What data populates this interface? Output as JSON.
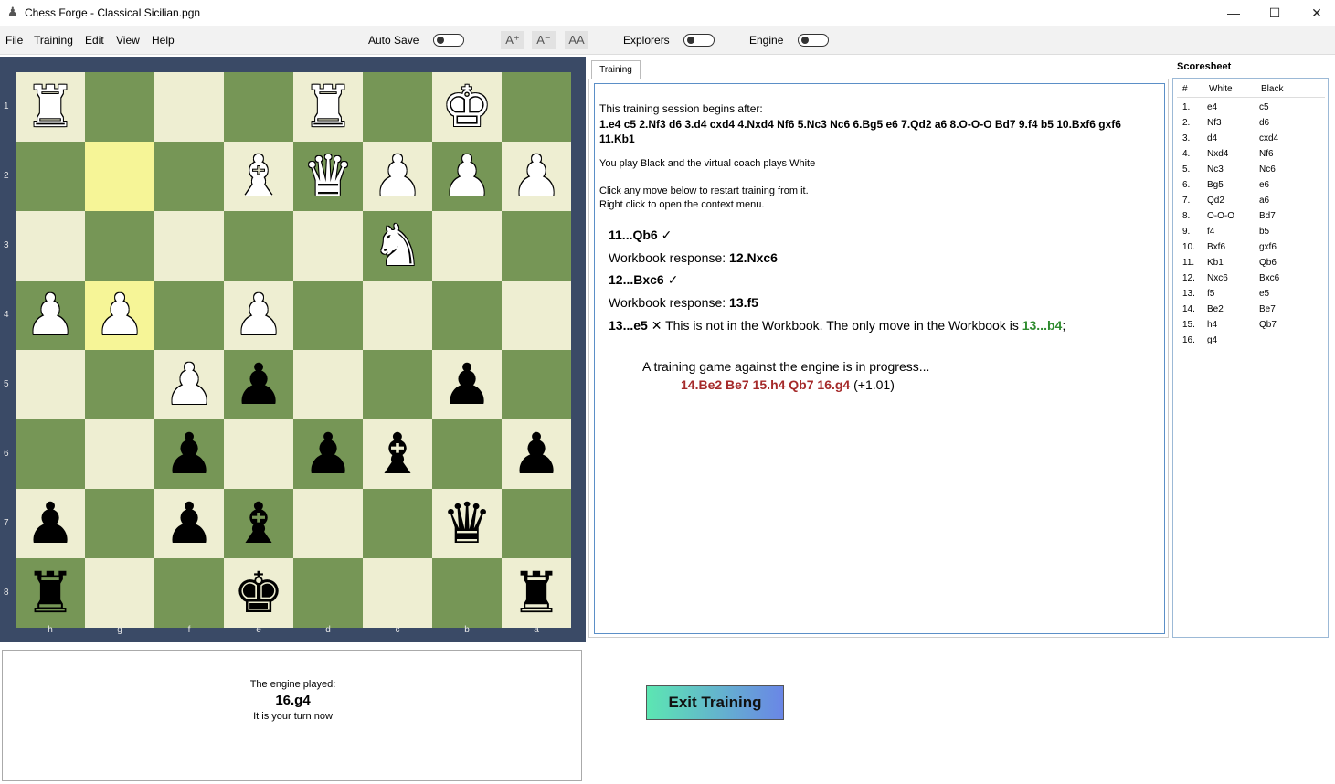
{
  "window": {
    "title": "Chess Forge - Classical Sicilian.pgn",
    "icon": "chess-pawn-icon",
    "minimize": "—",
    "maximize": "☐",
    "close": "✕"
  },
  "menu": [
    "File",
    "Training",
    "Edit",
    "View",
    "Help"
  ],
  "toolbar": {
    "auto_save": "Auto Save",
    "font_up": "A⁺",
    "font_down": "A⁻",
    "font_fixed": "AA",
    "explorers": "Explorers",
    "engine": "Engine"
  },
  "board": {
    "orientation": "black",
    "rank_labels": [
      "1",
      "2",
      "3",
      "4",
      "5",
      "6",
      "7",
      "8"
    ],
    "file_labels": [
      "h",
      "g",
      "f",
      "e",
      "d",
      "c",
      "b",
      "a"
    ],
    "light_color": "#eeeed2",
    "dark_color": "#769656",
    "highlight_color": "#f6f597",
    "highlighted_squares": [
      "g2",
      "g4"
    ],
    "pieces": [
      {
        "square": "h1",
        "glyph": "♜",
        "color": "white"
      },
      {
        "square": "d1",
        "glyph": "♜",
        "color": "white"
      },
      {
        "square": "b1",
        "glyph": "♚",
        "color": "white"
      },
      {
        "square": "e2",
        "glyph": "♝",
        "color": "white"
      },
      {
        "square": "d2",
        "glyph": "♛",
        "color": "white"
      },
      {
        "square": "c2",
        "glyph": "♟",
        "color": "white"
      },
      {
        "square": "b2",
        "glyph": "♟",
        "color": "white"
      },
      {
        "square": "a2",
        "glyph": "♟",
        "color": "white"
      },
      {
        "square": "c3",
        "glyph": "♞",
        "color": "white"
      },
      {
        "square": "h4",
        "glyph": "♟",
        "color": "white"
      },
      {
        "square": "g4",
        "glyph": "♟",
        "color": "white"
      },
      {
        "square": "e4",
        "glyph": "♟",
        "color": "white"
      },
      {
        "square": "f5",
        "glyph": "♟",
        "color": "white"
      },
      {
        "square": "e5",
        "glyph": "♟",
        "color": "black"
      },
      {
        "square": "b5",
        "glyph": "♟",
        "color": "black"
      },
      {
        "square": "f6",
        "glyph": "♟",
        "color": "black"
      },
      {
        "square": "d6",
        "glyph": "♟",
        "color": "black"
      },
      {
        "square": "c6",
        "glyph": "♝",
        "color": "black"
      },
      {
        "square": "a6",
        "glyph": "♟",
        "color": "black"
      },
      {
        "square": "h7",
        "glyph": "♟",
        "color": "black"
      },
      {
        "square": "f7",
        "glyph": "♟",
        "color": "black"
      },
      {
        "square": "e7",
        "glyph": "♝",
        "color": "black"
      },
      {
        "square": "b7",
        "glyph": "♛",
        "color": "black"
      },
      {
        "square": "h8",
        "glyph": "♜",
        "color": "black"
      },
      {
        "square": "e8",
        "glyph": "♚",
        "color": "black"
      },
      {
        "square": "a8",
        "glyph": "♜",
        "color": "black"
      }
    ]
  },
  "training": {
    "tab_label": "Training",
    "intro": "This training session begins after:",
    "start_moves": "1.e4 c5 2.Nf3 d6 3.d4 cxd4 4.Nxd4 Nf6 5.Nc3 Nc6 6.Bg5 e6 7.Qd2 a6 8.O-O-O Bd7 9.f4 b5 10.Bxf6 gxf6 11.Kb1",
    "role_text": "You play Black and the virtual coach plays White",
    "hint1": "Click any move below to restart training from it.",
    "hint2": "Right click to open the context menu.",
    "move1": "11...Qb6",
    "check_mark": "✓",
    "resp_label": "Workbook response: ",
    "resp1": "12.Nxc6",
    "move2": "12...Bxc6",
    "resp2": "13.f5",
    "move3": "13...e5",
    "cross_mark": "✕",
    "not_in_wb": " This is not in the Workbook. The only move in the Workbook is ",
    "wb_move": "13...b4",
    "semicolon": ";",
    "engine_progress": "A training game against the engine is in progress...",
    "engine_line": "14.Be2 Be7 15.h4 Qb7 16.g4",
    "engine_eval": " (+1.01)"
  },
  "scoresheet": {
    "title": "Scoresheet",
    "headers": [
      "#",
      "White",
      "Black"
    ],
    "rows": [
      [
        "1.",
        "e4",
        "c5"
      ],
      [
        "2.",
        "Nf3",
        "d6"
      ],
      [
        "3.",
        "d4",
        "cxd4"
      ],
      [
        "4.",
        "Nxd4",
        "Nf6"
      ],
      [
        "5.",
        "Nc3",
        "Nc6"
      ],
      [
        "6.",
        "Bg5",
        "e6"
      ],
      [
        "7.",
        "Qd2",
        "a6"
      ],
      [
        "8.",
        "O-O-O",
        "Bd7"
      ],
      [
        "9.",
        "f4",
        "b5"
      ],
      [
        "10.",
        "Bxf6",
        "gxf6"
      ],
      [
        "11.",
        "Kb1",
        "Qb6"
      ],
      [
        "12.",
        "Nxc6",
        "Bxc6"
      ],
      [
        "13.",
        "f5",
        "e5"
      ],
      [
        "14.",
        "Be2",
        "Be7"
      ],
      [
        "15.",
        "h4",
        "Qb7"
      ],
      [
        "16.",
        "g4",
        ""
      ]
    ]
  },
  "message": {
    "line1": "The engine played:",
    "move": "16.g4",
    "line3": "It is your turn now"
  },
  "exit_button": "Exit Training"
}
